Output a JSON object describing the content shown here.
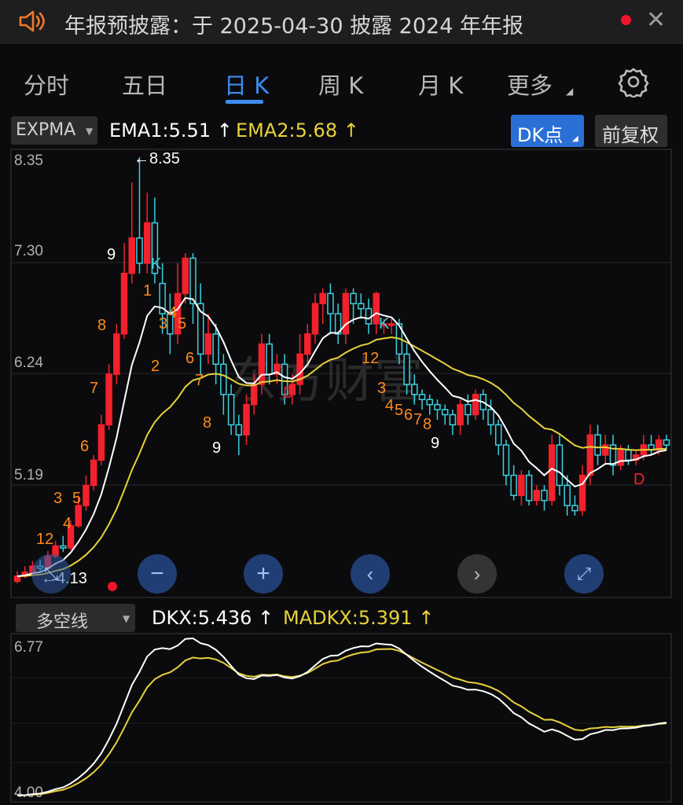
{
  "banner": {
    "text": "年报预披露：于 2025-04-30 披露 2024 年年报",
    "speaker_icon": "speaker-icon",
    "close_icon": "close-icon"
  },
  "tabs": [
    {
      "label": "分时",
      "active": false
    },
    {
      "label": "五日",
      "active": false
    },
    {
      "label": "日 K",
      "active": true
    },
    {
      "label": "周 K",
      "active": false
    },
    {
      "label": "月 K",
      "active": false
    },
    {
      "label": "更多",
      "active": false
    }
  ],
  "indicator_bar": {
    "main_indicator": "EXPMA",
    "ema1": "EMA1:5.51",
    "ema2": "EMA2:5.68",
    "dk_button": "DK点",
    "adjust_button": "前复权"
  },
  "price_chart": {
    "y_ticks": [
      "8.35",
      "7.30",
      "6.24",
      "5.19",
      "4.13"
    ],
    "high_label": "8.35",
    "low_label": "4.13",
    "watermark": "东方财富"
  },
  "lower_bar": {
    "indicator": "多空线",
    "dkx": "DKX:5.436",
    "madkx": "MADKX:5.391"
  },
  "lower_chart": {
    "y_ticks": [
      "6.77",
      "4.00"
    ]
  },
  "colors": {
    "up": "#f2212c",
    "down": "#3ad1e0",
    "ema1": "#ffffff",
    "ema2": "#e6d23a",
    "signal": "#ff8a1c",
    "accent": "#3d8ef0"
  }
}
